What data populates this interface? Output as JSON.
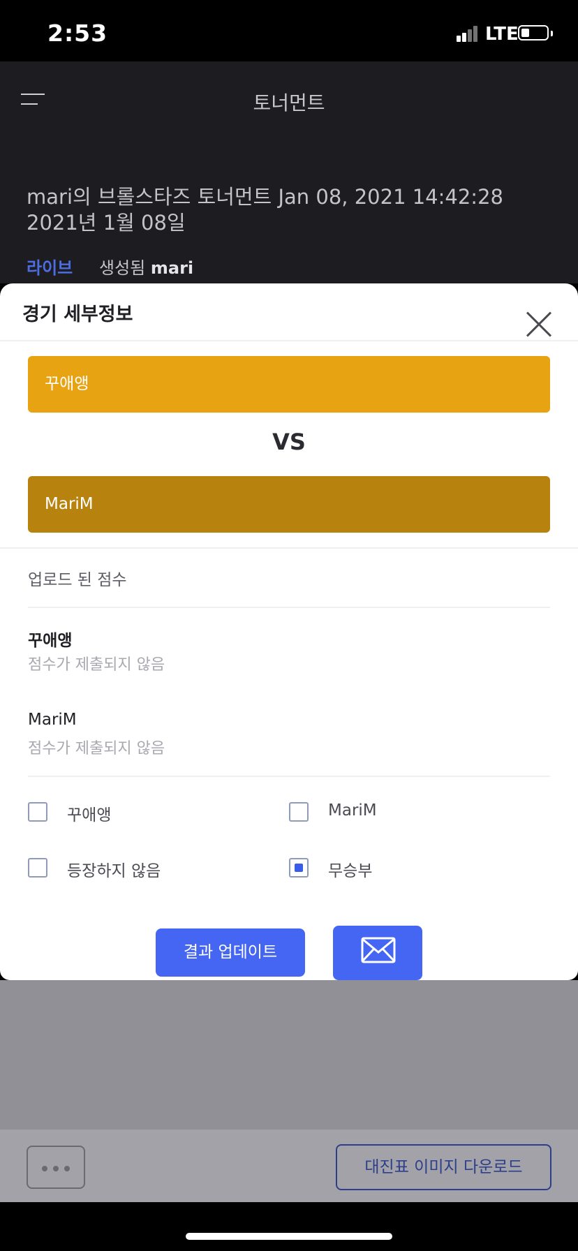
{
  "status_bar": {
    "time": "2:53",
    "network": "LTE"
  },
  "header": {
    "title": "토너먼트",
    "menu_icon": "hamburger-menu-icon"
  },
  "tournament": {
    "title_line1": "mari의 브롤스타즈 토너먼트 Jan 08, 2021 14:42:28",
    "title_line2": "2021년 1월 08일",
    "status": "라이브",
    "created_label": "생성됨",
    "creator": "mari"
  },
  "modal": {
    "title": "경기 세부정보",
    "close_icon": "close-icon",
    "team1": {
      "name": "꾸애앵",
      "color": "#e8a313"
    },
    "vs": "VS",
    "team2": {
      "name": "MariM",
      "color": "#b8820f"
    },
    "uploaded_scores_label": "업로드 된 점수",
    "scores": [
      {
        "name": "꾸애앵",
        "status": "점수가 제출되지 않음"
      },
      {
        "name": "MariM",
        "status": "점수가 제출되지 않음"
      }
    ],
    "options": [
      {
        "label": "꾸애앵",
        "checked": false
      },
      {
        "label": "MariM",
        "checked": false
      },
      {
        "label": "등장하지 않음",
        "checked": false
      },
      {
        "label": "무승부",
        "checked": true
      }
    ],
    "update_button": "결과 업데이트",
    "mail_icon": "envelope-icon"
  },
  "bottom": {
    "more_icon": "more-dots-icon",
    "download_button": "대진표 이미지 다운로드"
  }
}
